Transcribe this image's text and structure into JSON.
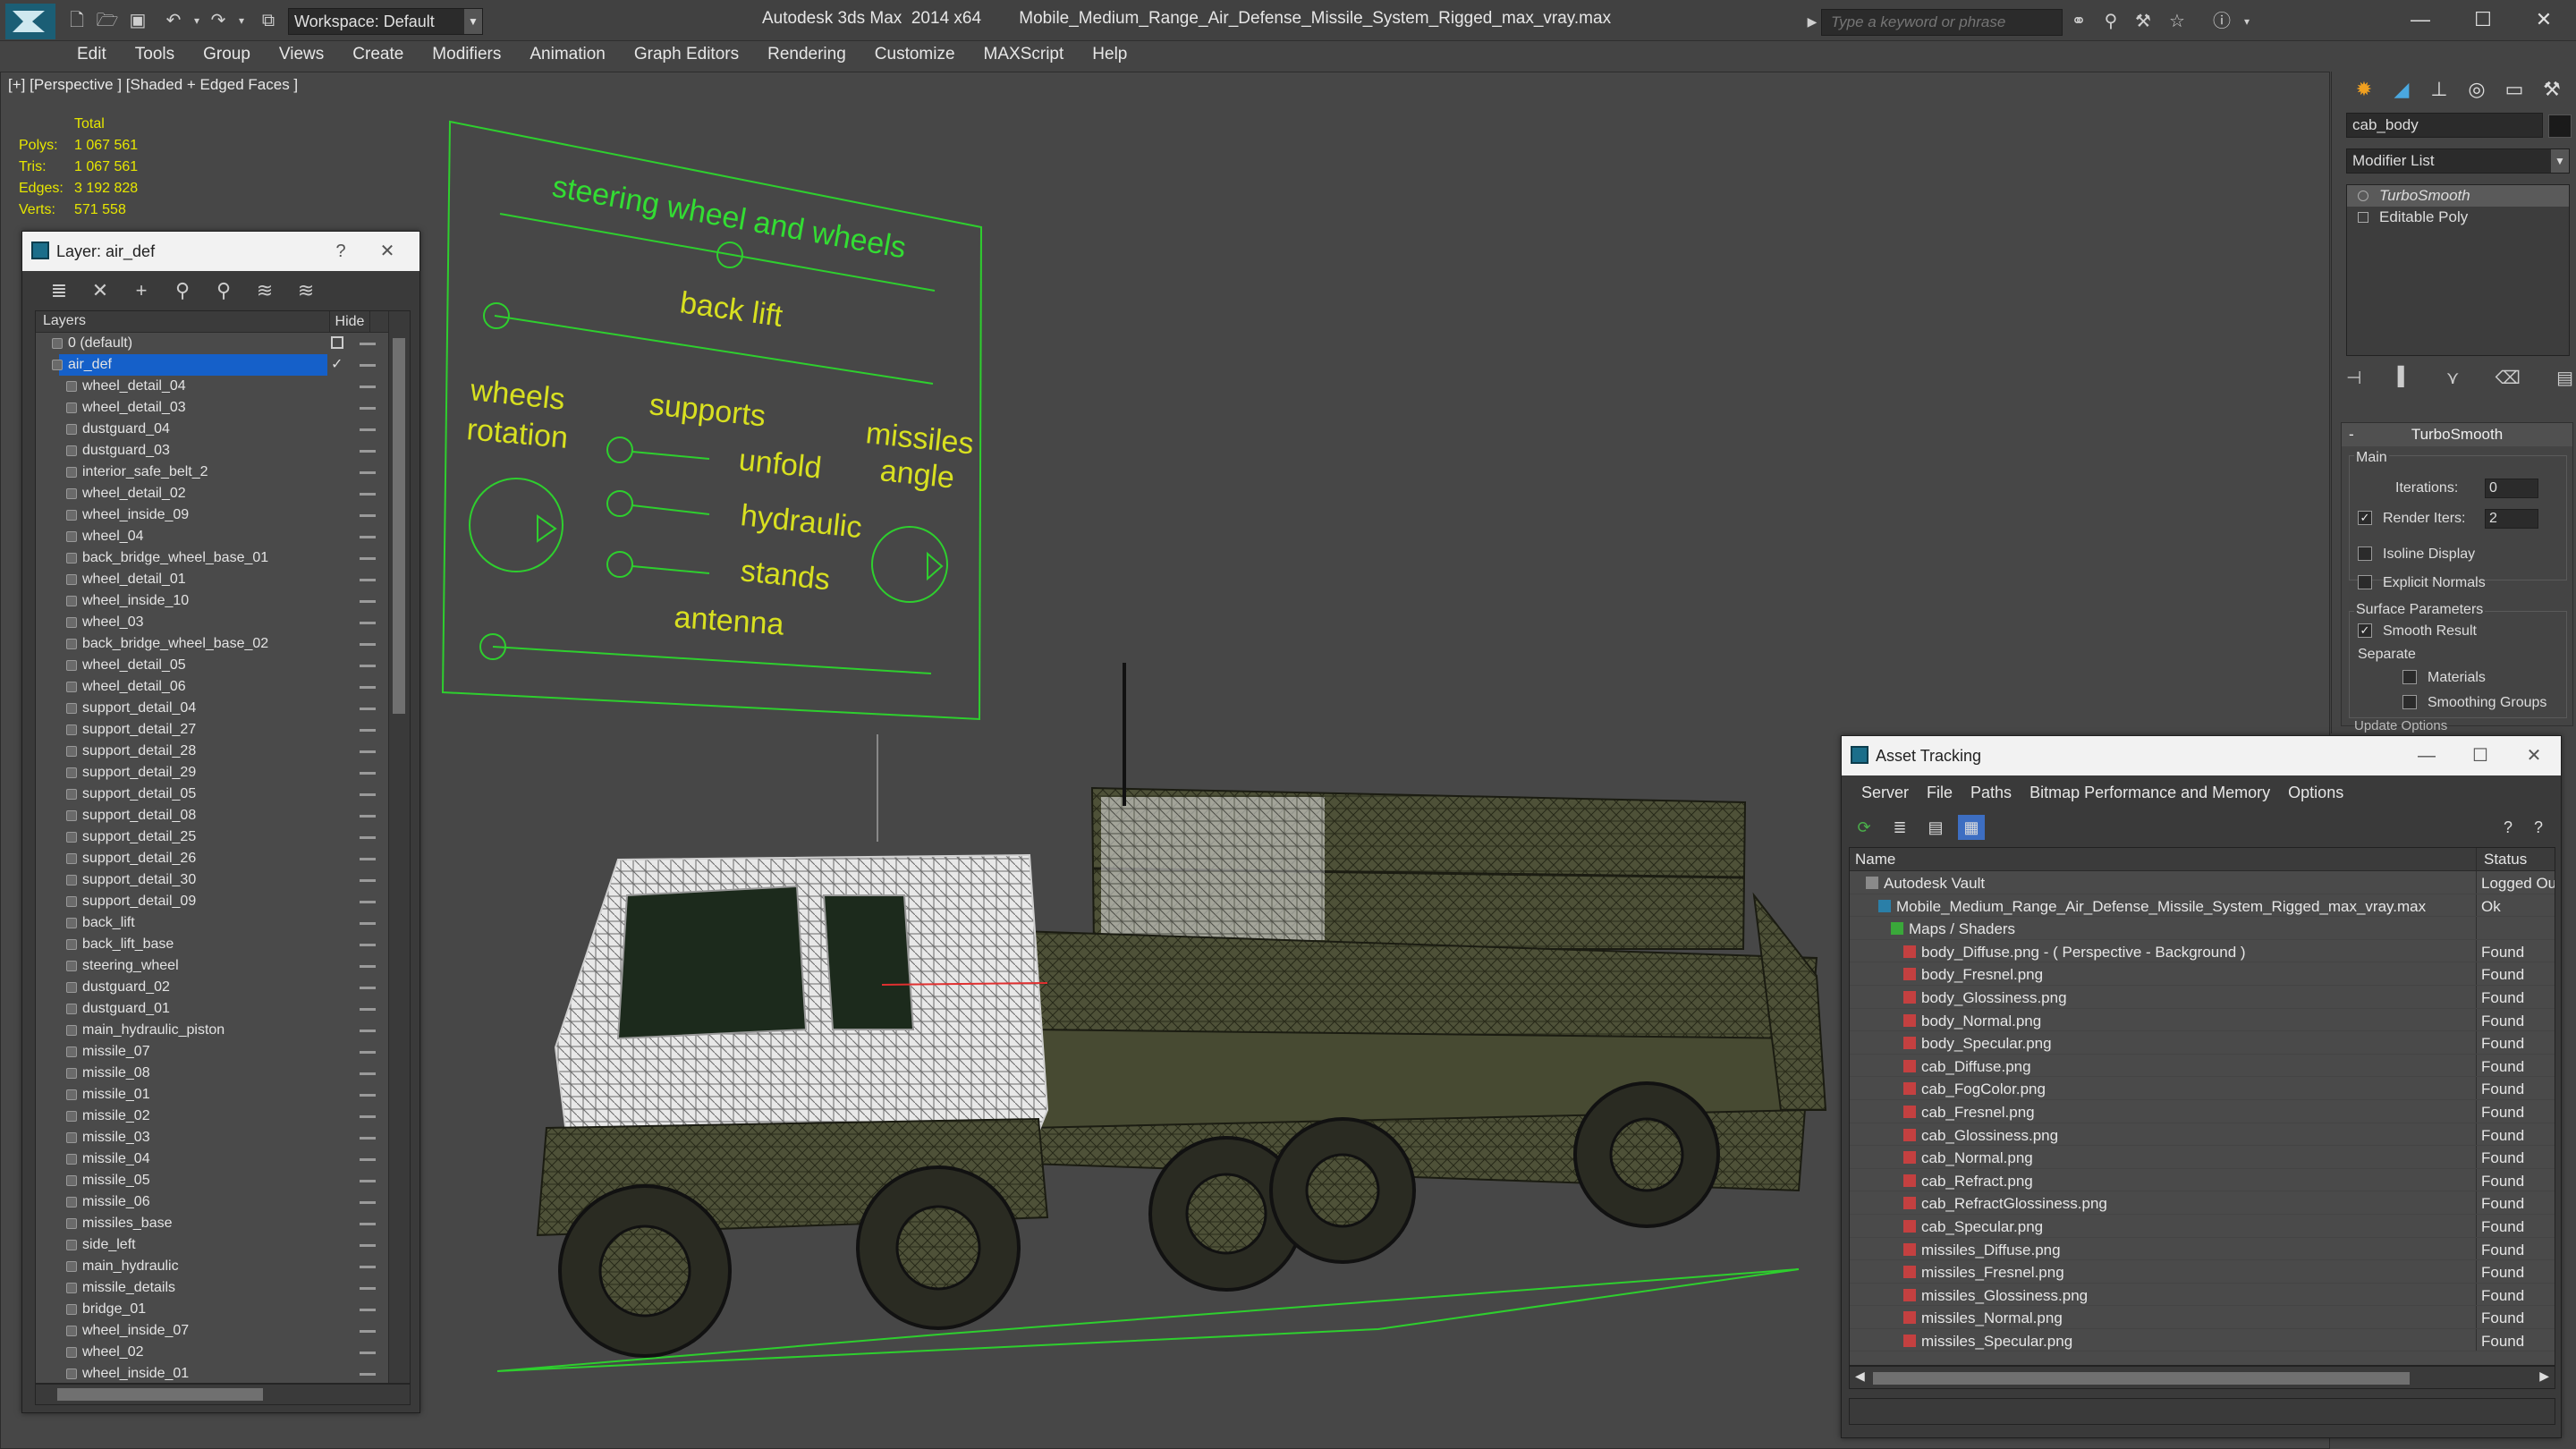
{
  "titlebar": {
    "workspace": "Workspace: Default",
    "title": "Autodesk 3ds Max  2014 x64        Mobile_Medium_Range_Air_Defense_Missile_System_Rigged_max_vray.max",
    "search_placeholder": "Type a keyword or phrase"
  },
  "menu": [
    "Edit",
    "Tools",
    "Group",
    "Views",
    "Create",
    "Modifiers",
    "Animation",
    "Graph Editors",
    "Rendering",
    "Customize",
    "MAXScript",
    "Help"
  ],
  "viewport": {
    "label": "[+] [Perspective ] [Shaded + Edged Faces ]",
    "stats_header": "Total",
    "stats": [
      {
        "k": "Polys:",
        "v": "1 067 561"
      },
      {
        "k": "Tris:",
        "v": "1 067 561"
      },
      {
        "k": "Edges:",
        "v": "3 192 828"
      },
      {
        "k": "Verts:",
        "v": "571 558"
      }
    ],
    "rig_labels": {
      "steering": "steering wheel and wheels",
      "backlift": "back lift",
      "wheels1": "wheels",
      "wheels2": "rotation",
      "supports": "supports",
      "missiles1": "missiles",
      "missiles2": "angle",
      "unfold": "unfold",
      "hydraulic": "hydraulic",
      "stands": "stands",
      "antenna": "antenna"
    }
  },
  "layer_panel": {
    "title": "Layer: air_def",
    "col_layers": "Layers",
    "col_hide": "Hide",
    "rows": [
      {
        "name": "0 (default)",
        "level": 0
      },
      {
        "name": "air_def",
        "level": 0,
        "selected": true
      },
      {
        "name": "wheel_detail_04",
        "level": 1
      },
      {
        "name": "wheel_detail_03",
        "level": 1
      },
      {
        "name": "dustguard_04",
        "level": 1
      },
      {
        "name": "dustguard_03",
        "level": 1
      },
      {
        "name": "interior_safe_belt_2",
        "level": 1
      },
      {
        "name": "wheel_detail_02",
        "level": 1
      },
      {
        "name": "wheel_inside_09",
        "level": 1
      },
      {
        "name": "wheel_04",
        "level": 1
      },
      {
        "name": "back_bridge_wheel_base_01",
        "level": 1
      },
      {
        "name": "wheel_detail_01",
        "level": 1
      },
      {
        "name": "wheel_inside_10",
        "level": 1
      },
      {
        "name": "wheel_03",
        "level": 1
      },
      {
        "name": "back_bridge_wheel_base_02",
        "level": 1
      },
      {
        "name": "wheel_detail_05",
        "level": 1
      },
      {
        "name": "wheel_detail_06",
        "level": 1
      },
      {
        "name": "support_detail_04",
        "level": 1
      },
      {
        "name": "support_detail_27",
        "level": 1
      },
      {
        "name": "support_detail_28",
        "level": 1
      },
      {
        "name": "support_detail_29",
        "level": 1
      },
      {
        "name": "support_detail_05",
        "level": 1
      },
      {
        "name": "support_detail_08",
        "level": 1
      },
      {
        "name": "support_detail_25",
        "level": 1
      },
      {
        "name": "support_detail_26",
        "level": 1
      },
      {
        "name": "support_detail_30",
        "level": 1
      },
      {
        "name": "support_detail_09",
        "level": 1
      },
      {
        "name": "back_lift",
        "level": 1
      },
      {
        "name": "back_lift_base",
        "level": 1
      },
      {
        "name": "steering_wheel",
        "level": 1
      },
      {
        "name": "dustguard_02",
        "level": 1
      },
      {
        "name": "dustguard_01",
        "level": 1
      },
      {
        "name": "main_hydraulic_piston",
        "level": 1
      },
      {
        "name": "missile_07",
        "level": 1
      },
      {
        "name": "missile_08",
        "level": 1
      },
      {
        "name": "missile_01",
        "level": 1
      },
      {
        "name": "missile_02",
        "level": 1
      },
      {
        "name": "missile_03",
        "level": 1
      },
      {
        "name": "missile_04",
        "level": 1
      },
      {
        "name": "missile_05",
        "level": 1
      },
      {
        "name": "missile_06",
        "level": 1
      },
      {
        "name": "missiles_base",
        "level": 1
      },
      {
        "name": "side_left",
        "level": 1
      },
      {
        "name": "main_hydraulic",
        "level": 1
      },
      {
        "name": "missile_details",
        "level": 1
      },
      {
        "name": "bridge_01",
        "level": 1
      },
      {
        "name": "wheel_inside_07",
        "level": 1
      },
      {
        "name": "wheel_02",
        "level": 1
      },
      {
        "name": "wheel_inside_01",
        "level": 1
      }
    ]
  },
  "command_panel": {
    "object_name": "cab_body",
    "modifier_list": "Modifier List",
    "stack": [
      "TurboSmooth",
      "Editable Poly"
    ],
    "turbosmooth": {
      "title": "TurboSmooth",
      "main": "Main",
      "iterations_label": "Iterations:",
      "iterations": "0",
      "render_iters_label": "Render Iters:",
      "render_iters": "2",
      "isoline": "Isoline Display",
      "explicit_normals": "Explicit Normals",
      "surface_params": "Surface Parameters",
      "smooth_result": "Smooth Result",
      "separate": "Separate",
      "materials": "Materials",
      "smoothing_groups": "Smoothing Groups",
      "update_options": "Update Options"
    }
  },
  "asset_panel": {
    "title": "Asset Tracking",
    "menu": [
      "Server",
      "File",
      "Paths",
      "Bitmap Performance and Memory",
      "Options"
    ],
    "col_name": "Name",
    "col_status": "Status",
    "rows": [
      {
        "name": "Autodesk Vault",
        "status": "Logged Ou",
        "level": 0,
        "icon": "vault"
      },
      {
        "name": "Mobile_Medium_Range_Air_Defense_Missile_System_Rigged_max_vray.max",
        "status": "Ok",
        "level": 1,
        "icon": "max"
      },
      {
        "name": "Maps / Shaders",
        "status": "",
        "level": 2,
        "icon": "maps"
      },
      {
        "name": "body_Diffuse.png - ( Perspective - Background )",
        "status": "Found",
        "level": 3,
        "icon": "png"
      },
      {
        "name": "body_Fresnel.png",
        "status": "Found",
        "level": 3,
        "icon": "png"
      },
      {
        "name": "body_Glossiness.png",
        "status": "Found",
        "level": 3,
        "icon": "png"
      },
      {
        "name": "body_Normal.png",
        "status": "Found",
        "level": 3,
        "icon": "png"
      },
      {
        "name": "body_Specular.png",
        "status": "Found",
        "level": 3,
        "icon": "png"
      },
      {
        "name": "cab_Diffuse.png",
        "status": "Found",
        "level": 3,
        "icon": "png"
      },
      {
        "name": "cab_FogColor.png",
        "status": "Found",
        "level": 3,
        "icon": "png"
      },
      {
        "name": "cab_Fresnel.png",
        "status": "Found",
        "level": 3,
        "icon": "png"
      },
      {
        "name": "cab_Glossiness.png",
        "status": "Found",
        "level": 3,
        "icon": "png"
      },
      {
        "name": "cab_Normal.png",
        "status": "Found",
        "level": 3,
        "icon": "png"
      },
      {
        "name": "cab_Refract.png",
        "status": "Found",
        "level": 3,
        "icon": "png"
      },
      {
        "name": "cab_RefractGlossiness.png",
        "status": "Found",
        "level": 3,
        "icon": "png"
      },
      {
        "name": "cab_Specular.png",
        "status": "Found",
        "level": 3,
        "icon": "png"
      },
      {
        "name": "missiles_Diffuse.png",
        "status": "Found",
        "level": 3,
        "icon": "png"
      },
      {
        "name": "missiles_Fresnel.png",
        "status": "Found",
        "level": 3,
        "icon": "png"
      },
      {
        "name": "missiles_Glossiness.png",
        "status": "Found",
        "level": 3,
        "icon": "png"
      },
      {
        "name": "missiles_Normal.png",
        "status": "Found",
        "level": 3,
        "icon": "png"
      },
      {
        "name": "missiles_Specular.png",
        "status": "Found",
        "level": 3,
        "icon": "png"
      }
    ]
  },
  "colors": {
    "rig_green": "#33dd33",
    "rig_yellow": "#d8e020",
    "stats_yellow": "#e6e600",
    "selection_blue": "#1560c9"
  }
}
